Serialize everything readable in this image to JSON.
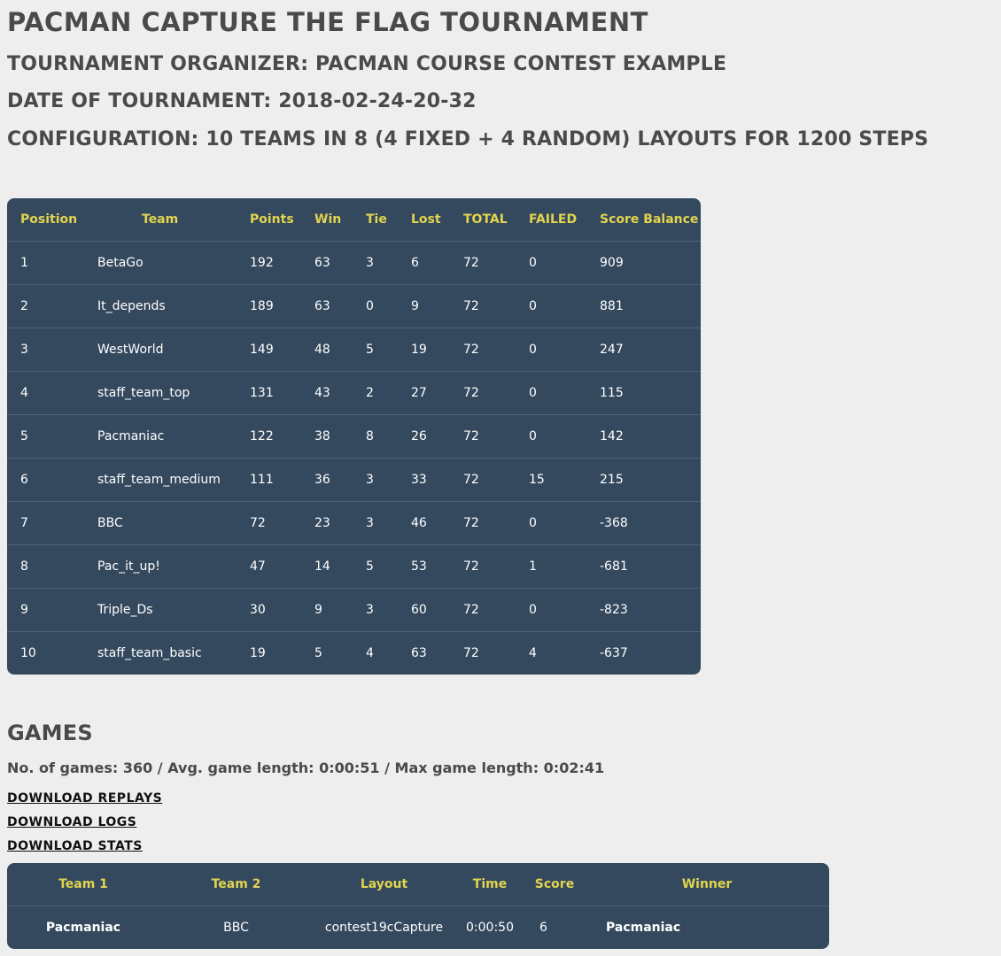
{
  "title": "Pacman Capture the Flag Tournament",
  "organizer": "Tournament Organizer: Pacman Course Contest Example",
  "date": "Date of Tournament: 2018-02-24-20-32",
  "configuration": "Configuration: 10 teams in 8 (4 fixed + 4 random) layouts for 1200 steps",
  "ranking": {
    "headers": [
      "Position",
      "Team",
      "Points",
      "Win",
      "Tie",
      "Lost",
      "TOTAL",
      "FAILED",
      "Score Balance"
    ],
    "rows": [
      [
        "1",
        "BetaGo",
        "192",
        "63",
        "3",
        "6",
        "72",
        "0",
        "909"
      ],
      [
        "2",
        "It_depends",
        "189",
        "63",
        "0",
        "9",
        "72",
        "0",
        "881"
      ],
      [
        "3",
        "WestWorld",
        "149",
        "48",
        "5",
        "19",
        "72",
        "0",
        "247"
      ],
      [
        "4",
        "staff_team_top",
        "131",
        "43",
        "2",
        "27",
        "72",
        "0",
        "115"
      ],
      [
        "5",
        "Pacmaniac",
        "122",
        "38",
        "8",
        "26",
        "72",
        "0",
        "142"
      ],
      [
        "6",
        "staff_team_medium",
        "111",
        "36",
        "3",
        "33",
        "72",
        "15",
        "215"
      ],
      [
        "7",
        "BBC",
        "72",
        "23",
        "3",
        "46",
        "72",
        "0",
        "-368"
      ],
      [
        "8",
        "Pac_it_up!",
        "47",
        "14",
        "5",
        "53",
        "72",
        "1",
        "-681"
      ],
      [
        "9",
        "Triple_Ds",
        "30",
        "9",
        "3",
        "60",
        "72",
        "0",
        "-823"
      ],
      [
        "10",
        "staff_team_basic",
        "19",
        "5",
        "4",
        "63",
        "72",
        "4",
        "-637"
      ]
    ]
  },
  "games": {
    "title": "Games",
    "summary": "No. of games: 360 / Avg. game length: 0:00:51 / Max game length: 0:02:41",
    "download_replays": "Download replays",
    "download_logs": "Download logs",
    "download_stats": "Download stats",
    "headers": [
      "Team 1",
      "Team 2",
      "Layout",
      "Time",
      "Score",
      "Winner"
    ],
    "rows": [
      [
        "Pacmaniac",
        "BBC",
        "contest19cCapture",
        "0:00:50",
        "6",
        "Pacmaniac"
      ]
    ]
  },
  "colors": {
    "background": "#eeeeee",
    "table_bg": "#34495e",
    "header_text": "#e2d44e",
    "cell_text": "#ffffff",
    "heading_text": "#4a4a4a"
  }
}
